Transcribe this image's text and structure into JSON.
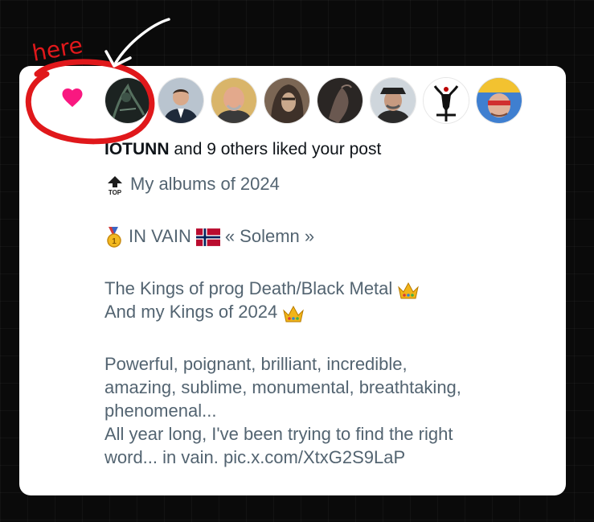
{
  "annotation": {
    "label": "here",
    "color": "#e0181b"
  },
  "notification": {
    "liker_name": "IOTUNN",
    "liked_suffix": " and 9 others liked your post",
    "heart_color": "#f91880",
    "avatars": [
      {
        "name": "avatar-dark-art"
      },
      {
        "name": "avatar-man-suit"
      },
      {
        "name": "avatar-bald-man"
      },
      {
        "name": "avatar-hooded-figure"
      },
      {
        "name": "avatar-horse"
      },
      {
        "name": "avatar-man-hat"
      },
      {
        "name": "avatar-baphomet"
      },
      {
        "name": "avatar-man-painted-face"
      }
    ]
  },
  "post": {
    "title_line": "My albums of 2024",
    "award_line_a": "IN VAIN",
    "award_line_b": "« Solemn »",
    "kings_line1": "The Kings of prog Death/Black Metal",
    "kings_line2": "And my Kings of 2024",
    "body_line1": "Powerful, poignant, brilliant, incredible,",
    "body_line2": "amazing, sublime, monumental, breathtaking,",
    "body_line3": "phenomenal...",
    "body_line4": "All year long, I've been trying to find the right",
    "body_line5": "word... in vain. pic.x.com/XtxG2S9LaP"
  }
}
